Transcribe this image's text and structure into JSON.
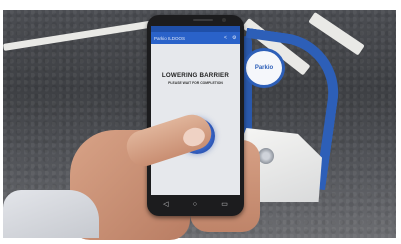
{
  "app": {
    "title": "Parkio ILDOOS",
    "actions": [
      {
        "icon": "share-icon",
        "glyph": "<"
      },
      {
        "icon": "gear-icon",
        "glyph": "⚙"
      }
    ]
  },
  "status": {
    "headline": "LOWERING BARRIER",
    "subline": "PLEASE WAIT FOR COMPLETION"
  },
  "action_button": {
    "icon": "lock-button"
  },
  "nav": [
    {
      "icon": "back-icon",
      "glyph": "◁"
    },
    {
      "icon": "home-icon",
      "glyph": "○"
    },
    {
      "icon": "recents-icon",
      "glyph": "▭"
    }
  ],
  "barrier_sign": "Parkio",
  "colors": {
    "accent": "#2a62c9",
    "barrier": "#2d5fb8"
  }
}
